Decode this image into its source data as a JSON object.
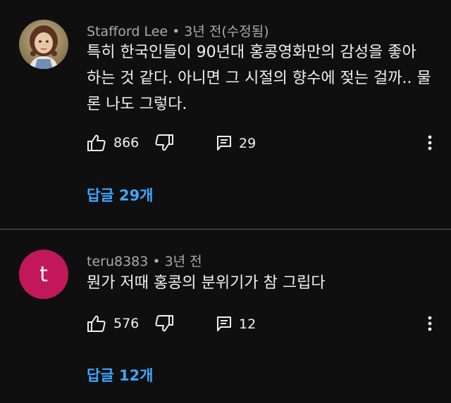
{
  "comments": [
    {
      "author": "Stafford Lee",
      "time": "3년 전(수정됨)",
      "text": "특히 한국인들이 90년대 홍콩영화만의 감성을 좋아\n하는 것 같다. 아니면 그 시절의 향수에 젖는 걸까.. 물\n론 나도 그렇다.",
      "likes": "866",
      "reply_count": "29",
      "replies_label": "답글 29개",
      "avatar_icon": "profile-photo-avatar"
    },
    {
      "author": "teru8383",
      "time": "3년 전",
      "text": "뭔가 저때 홍콩의 분위기가 참 그립다",
      "likes": "576",
      "reply_count": "12",
      "replies_label": "답글 12개",
      "avatar_letter": "t",
      "avatar_color": "#c2185b"
    }
  ],
  "colors": {
    "background": "#0f0f0f",
    "link": "#3ea6ff",
    "meta": "#aaaaaa"
  }
}
